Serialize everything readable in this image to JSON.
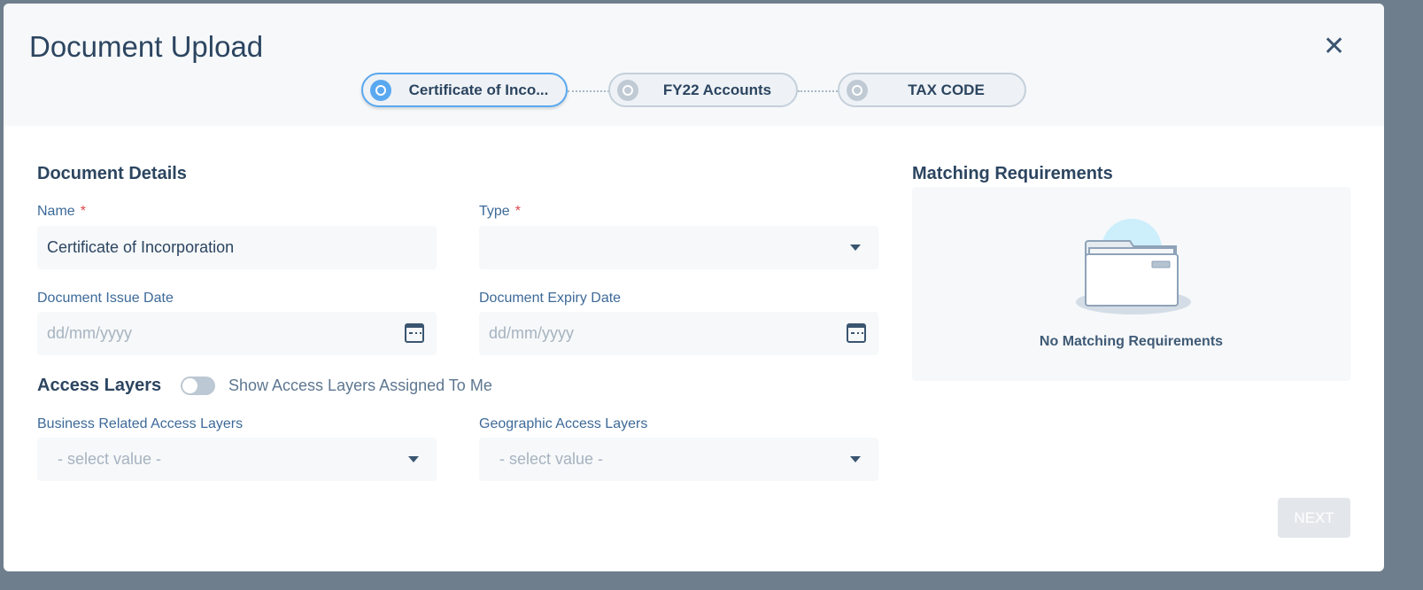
{
  "modal": {
    "title": "Document Upload",
    "close_icon": "close-icon"
  },
  "steps": [
    {
      "label": "Certificate of Inco...",
      "active": true
    },
    {
      "label": "FY22 Accounts",
      "active": false
    },
    {
      "label": "TAX CODE",
      "active": false
    }
  ],
  "details": {
    "heading": "Document Details",
    "name_label": "Name",
    "name_value": "Certificate of Incorporation",
    "required": "*",
    "type_label": "Type",
    "type_value": "",
    "issue_label": "Document Issue Date",
    "issue_placeholder": "dd/mm/yyyy",
    "expiry_label": "Document Expiry Date",
    "expiry_placeholder": "dd/mm/yyyy"
  },
  "access": {
    "heading": "Access Layers",
    "toggle_label": "Show Access Layers Assigned To Me",
    "toggle_on": false,
    "business_label": "Business Related Access Layers",
    "business_placeholder": "- select value -",
    "geo_label": "Geographic Access Layers",
    "geo_placeholder": "- select value -"
  },
  "matching": {
    "heading": "Matching Requirements",
    "empty_text": "No Matching Requirements"
  },
  "footer": {
    "next_label": "NEXT",
    "next_enabled": false
  },
  "colors": {
    "accent": "#5aa8f0",
    "text": "#2c4560",
    "label": "#3d6a99",
    "required": "#e04848"
  }
}
